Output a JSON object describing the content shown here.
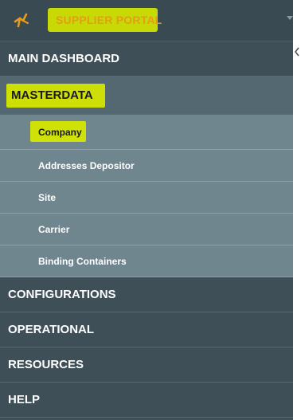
{
  "header": {
    "brand": "SUPPLIER PORTAL",
    "logo_icon": "runner-logo-icon",
    "expand_icon": "caret-down-icon"
  },
  "collapse_icon": "chevron-left-icon",
  "menu": {
    "main_dashboard": "MAIN DASHBOARD",
    "masterdata": "MASTERDATA",
    "configurations": "CONFIGURATIONS",
    "operational": "OPERATIONAL",
    "resources": "RESOURCES",
    "help": "HELP"
  },
  "submenu": {
    "company": "Company",
    "addresses_depositor": "Addresses Depositor",
    "site": "Site",
    "carrier": "Carrier",
    "binding_containers": "Binding Containers"
  },
  "colors": {
    "sidebar_bg": "#3e4f58",
    "submenu_bg": "#6f868f",
    "highlight": "#d4e600",
    "brand_text": "#e89a1a"
  }
}
